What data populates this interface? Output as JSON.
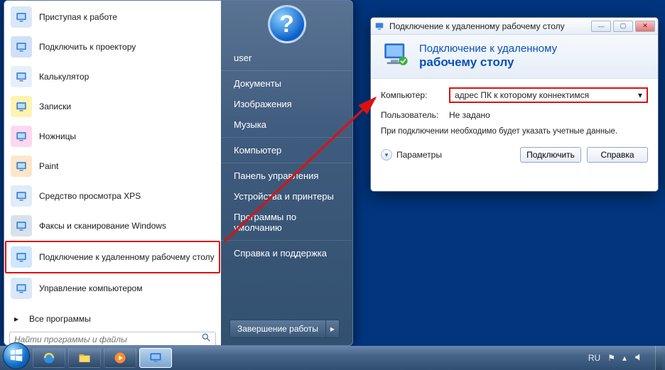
{
  "start_menu": {
    "left_items": [
      {
        "label": "Приступая к работе",
        "icon": "getting-started-icon",
        "bg": "#d9e8f8"
      },
      {
        "label": "Подключить к проектору",
        "icon": "projector-icon",
        "bg": "#cfe1f7"
      },
      {
        "label": "Калькулятор",
        "icon": "calculator-icon",
        "bg": "#e7eff9"
      },
      {
        "label": "Записки",
        "icon": "sticky-notes-icon",
        "bg": "#fff3b0"
      },
      {
        "label": "Ножницы",
        "icon": "snipping-tool-icon",
        "bg": "#ffd7ef"
      },
      {
        "label": "Paint",
        "icon": "paint-icon",
        "bg": "#fde6c9"
      },
      {
        "label": "Средство просмотра XPS",
        "icon": "xps-viewer-icon",
        "bg": "#e0ecf7"
      },
      {
        "label": "Факсы и сканирование Windows",
        "icon": "fax-scan-icon",
        "bg": "#d7e2ec"
      },
      {
        "label": "Подключение к удаленному рабочему столу",
        "icon": "rdp-icon",
        "bg": "#cfe7ff",
        "highlighted": true
      },
      {
        "label": "Управление компьютером",
        "icon": "computer-management-icon",
        "bg": "#d8e8f7"
      }
    ],
    "all_programs": "Все программы",
    "search_placeholder": "Найти программы и файлы",
    "right_items": [
      "user",
      "Документы",
      "Изображения",
      "Музыка",
      "Компьютер",
      "Панель управления",
      "Устройства и принтеры",
      "Программы по умолчанию",
      "Справка и поддержка"
    ],
    "shutdown_label": "Завершение работы",
    "avatar_glyph": "?"
  },
  "rdp": {
    "title": "Подключение к удаленному рабочему столу",
    "banner_line1": "Подключение к удаленному",
    "banner_line2": "рабочему столу",
    "computer_label": "Компьютер:",
    "computer_value": "адрес ПК к которому коннектимся",
    "user_label": "Пользователь:",
    "user_value": "Не задано",
    "note": "При подключении необходимо будет указать учетные данные.",
    "options": "Параметры",
    "connect": "Подключить",
    "help": "Справка"
  },
  "taskbar": {
    "items": [
      {
        "name": "ie-icon"
      },
      {
        "name": "explorer-icon"
      },
      {
        "name": "wmp-icon"
      },
      {
        "name": "rdp-task-icon",
        "active": true
      }
    ],
    "lang": "RU"
  }
}
